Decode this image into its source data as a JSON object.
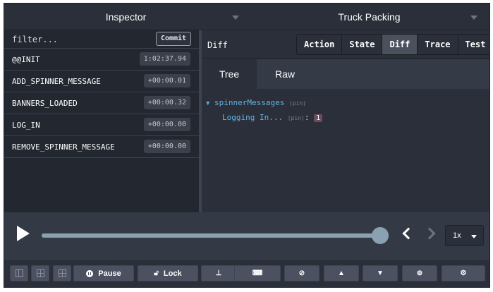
{
  "header": {
    "left_monitor": "Inspector",
    "right_monitor": "Truck Packing"
  },
  "filter": {
    "placeholder": "filter...",
    "commit_label": "Commit"
  },
  "actions": [
    {
      "name": "@@INIT",
      "time": "1:02:37.94"
    },
    {
      "name": "ADD_SPINNER_MESSAGE",
      "time": "+00:00.01"
    },
    {
      "name": "BANNERS_LOADED",
      "time": "+00:00.32"
    },
    {
      "name": "LOG_IN",
      "time": "+00:00.00"
    },
    {
      "name": "REMOVE_SPINNER_MESSAGE",
      "time": "+00:00.00"
    }
  ],
  "inspector": {
    "current_tab_label": "Diff",
    "tabs": [
      "Action",
      "State",
      "Diff",
      "Trace",
      "Test"
    ],
    "active_tab": "Diff",
    "view_tabs": [
      "Tree",
      "Raw"
    ],
    "active_view": "Tree"
  },
  "tree": {
    "root_key": "spinnerMessages",
    "root_pin": "(pin)",
    "child_key": "Logging In...",
    "child_pin": "(pin)",
    "child_colon": ":",
    "child_value": "1"
  },
  "slider": {
    "position": 1.0,
    "speed": "1x"
  },
  "bottom_bar": {
    "pause_label": "Pause",
    "lock_label": "Lock",
    "icons": [
      "layout-left-icon",
      "layout-bottom-icon",
      "layout-grid-icon",
      "pause-icon",
      "lock-icon",
      "pin-icon",
      "keyboard-icon",
      "persist-icon",
      "export-icon",
      "import-icon",
      "remote-icon",
      "settings-icon"
    ]
  },
  "colors": {
    "background": "#2a2f3a",
    "active_tab": "#4a505c",
    "tree_key": "#64b3e3",
    "diff_value": "#6e4a5d",
    "slider": "#8aa1b1"
  }
}
